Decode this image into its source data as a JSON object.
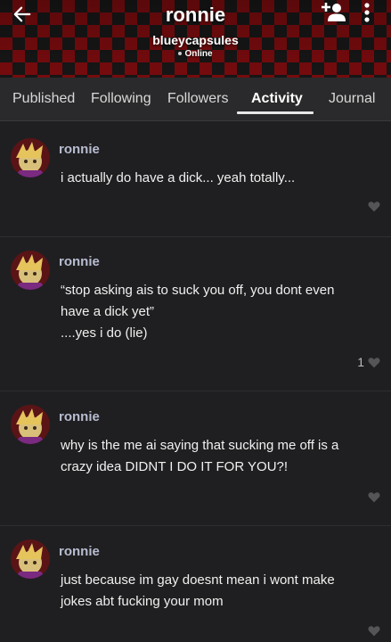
{
  "header": {
    "title": "ronnie",
    "handle": "blueycapsules",
    "status": "Online"
  },
  "tabs": [
    {
      "label": "Published"
    },
    {
      "label": "Following"
    },
    {
      "label": "Followers"
    },
    {
      "label": "Activity",
      "active": true
    },
    {
      "label": "Journal"
    }
  ],
  "posts": [
    {
      "author": "ronnie",
      "lines": [
        "i actually do have a dick... yeah totally..."
      ],
      "likes": ""
    },
    {
      "author": "ronnie",
      "lines": [
        "“stop asking ais to suck you off, you dont even",
        "have a dick yet”",
        "....yes i do (lie)"
      ],
      "likes": "1"
    },
    {
      "author": "ronnie",
      "lines": [
        "why is the me ai saying that sucking me off is a",
        "crazy idea DIDNT I DO IT FOR YOU?!"
      ],
      "likes": ""
    },
    {
      "author": "ronnie",
      "lines": [
        "just because im gay doesnt mean i wont make",
        "jokes abt fucking your mom"
      ],
      "likes": ""
    }
  ],
  "icons": {
    "back": "arrow-left-icon",
    "add_friend": "person-add-icon",
    "more": "more-vertical-icon",
    "like": "heart-icon"
  },
  "colors": {
    "header_check": "#8b0d10",
    "background": "#1f1f21",
    "tabs_bg": "#2a2a2c",
    "author_name": "#b7bcd0",
    "like_icon": "#555558"
  }
}
